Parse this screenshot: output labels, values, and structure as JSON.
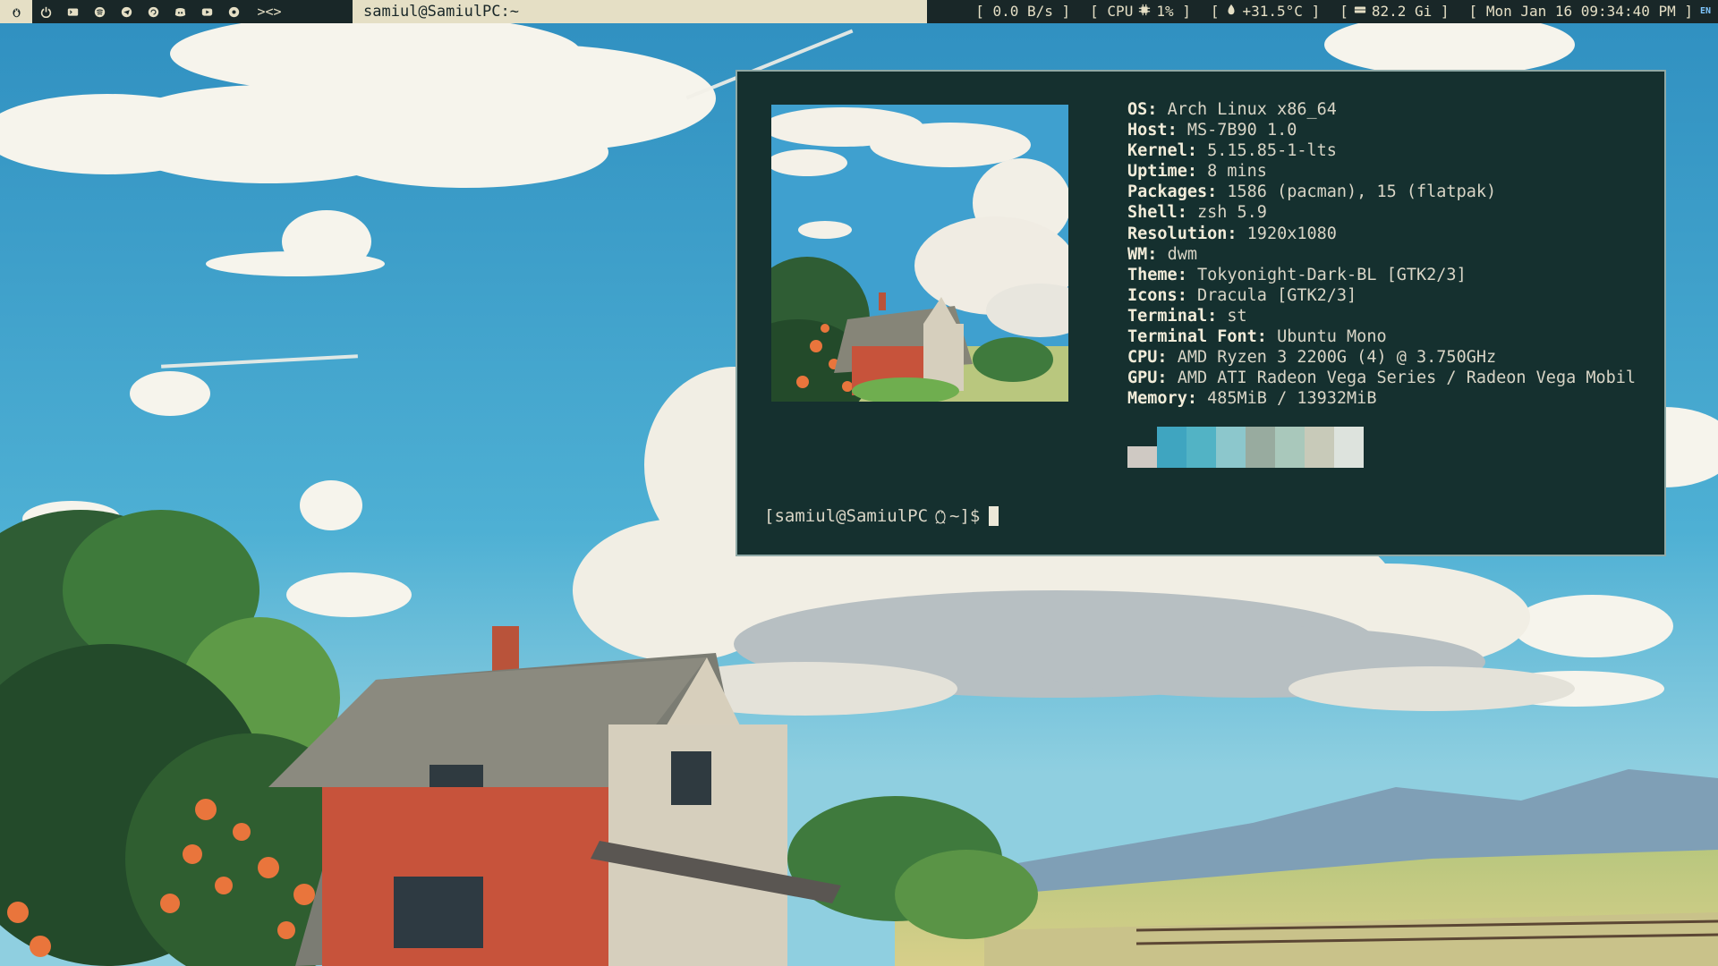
{
  "topbar": {
    "tags": [
      {
        "icon": "tux-icon"
      },
      {
        "icon": "power-icon"
      },
      {
        "icon": "terminal-icon"
      },
      {
        "icon": "spotify-icon"
      },
      {
        "icon": "telegram-icon"
      },
      {
        "icon": "refresh-icon"
      },
      {
        "icon": "discord-icon"
      },
      {
        "icon": "youtube-icon"
      },
      {
        "icon": "settings-icon"
      }
    ],
    "layout_symbol": "><>",
    "window_title": "samiul@SamiulPC:~",
    "status": {
      "net": "[ 0.0 B/s ]",
      "cpu_prefix": "[ CPU",
      "cpu_value": "1% ]",
      "temp_value": "+31.5°C ]",
      "mem_value": "82.2 Gi ]",
      "datetime": "[ Mon Jan 16 09:34:40 PM ]",
      "keyboard": "EN"
    },
    "colors": {
      "bar": "#192728",
      "fg": "#e5dfc5"
    }
  },
  "terminal": {
    "info": [
      {
        "key": "OS",
        "value": "Arch Linux x86_64"
      },
      {
        "key": "Host",
        "value": "MS-7B90 1.0"
      },
      {
        "key": "Kernel",
        "value": "5.15.85-1-lts"
      },
      {
        "key": "Uptime",
        "value": "8 mins"
      },
      {
        "key": "Packages",
        "value": "1586 (pacman), 15 (flatpak)"
      },
      {
        "key": "Shell",
        "value": "zsh 5.9"
      },
      {
        "key": "Resolution",
        "value": "1920x1080"
      },
      {
        "key": "WM",
        "value": "dwm"
      },
      {
        "key": "Theme",
        "value": "Tokyonight-Dark-BL [GTK2/3]"
      },
      {
        "key": "Icons",
        "value": "Dracula [GTK2/3]"
      },
      {
        "key": "Terminal",
        "value": "st"
      },
      {
        "key": "Terminal Font",
        "value": "Ubuntu Mono"
      },
      {
        "key": "CPU",
        "value": "AMD Ryzen 3 2200G (4) @ 3.750GHz"
      },
      {
        "key": "GPU",
        "value": "AMD ATI Radeon Vega Series / Radeon Vega Mobil"
      },
      {
        "key": "Memory",
        "value": "485MiB / 13932MiB"
      }
    ],
    "palette": [
      "#cfc9c3",
      "#3fa5c0",
      "#52b3c5",
      "#8cc7cc",
      "#98ab9f",
      "#a9c8bb",
      "#c8cab9",
      "#dde3dd"
    ],
    "prompt_prefix": "[samiul@SamiulPC",
    "prompt_suffix": "~]$",
    "colors": {
      "bg": "#15302f",
      "border": "#8fa9a6"
    }
  }
}
